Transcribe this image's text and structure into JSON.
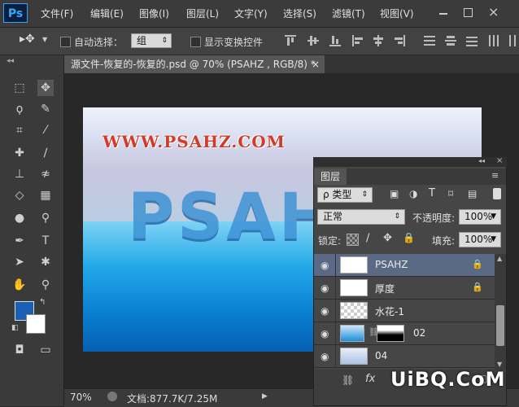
{
  "app": {
    "logo": "Ps"
  },
  "menu": [
    "文件(F)",
    "编辑(E)",
    "图像(I)",
    "图层(L)",
    "文字(Y)",
    "选择(S)",
    "滤镜(T)",
    "视图(V)"
  ],
  "options": {
    "auto_select_label": "自动选择：",
    "auto_select_value": "组",
    "transform_label": "显示变换控件"
  },
  "document": {
    "tab_title": "源文件-恢复的-恢复的.psd @ 70% (PSAHZ , RGB/8) *",
    "close_glyph": "×",
    "canvas_site": "WWW.PSAHZ.COM",
    "canvas_logo": "PSAHZ"
  },
  "status": {
    "zoom": "70%",
    "doc_info": "文档:877.7K/7.25M"
  },
  "layers_panel": {
    "tab": "图层",
    "filter_label": "ρ 类型",
    "blend_mode": "正常",
    "opacity_label": "不透明度:",
    "opacity_value": "100%",
    "lock_label": "锁定:",
    "fill_label": "填充:",
    "fill_value": "100%",
    "layers": [
      {
        "name": "PSAHZ",
        "locked": true,
        "selected": true
      },
      {
        "name": "厚度",
        "locked": true,
        "selected": false
      },
      {
        "name": "水花-1",
        "locked": false,
        "selected": false
      },
      {
        "name": "02",
        "locked": false,
        "selected": false,
        "has_mask": true
      },
      {
        "name": "04",
        "locked": false,
        "selected": false
      }
    ],
    "footer_fx": "fx"
  },
  "watermark": "UiBQ.CoM",
  "colors": {
    "foreground": "#1a5fb4",
    "background": "#ffffff",
    "selected_layer": "#5a6a84"
  }
}
